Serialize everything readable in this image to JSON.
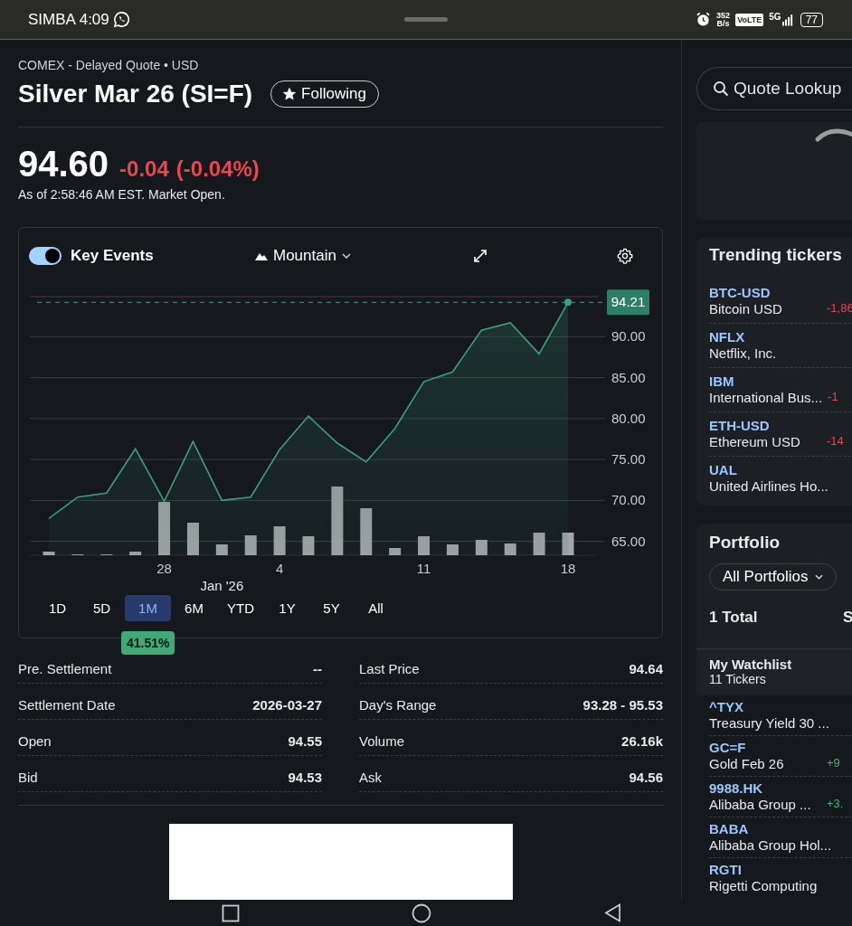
{
  "status_bar": {
    "carrier_time": "SIMBA 4:09",
    "speed_value": "352",
    "speed_unit": "B/s",
    "volte": "VoLTE",
    "network": "5G",
    "battery": "77"
  },
  "quote": {
    "source": "COMEX - Delayed Quote • USD",
    "title": "Silver Mar 26 (SI=F)",
    "follow": {
      "label": "Following",
      "selected": true
    },
    "price": "94.60",
    "change": "-0.04",
    "change_pct": "(-0.04%)",
    "as_of": "As of 2:58:46 AM EST. Market Open."
  },
  "chart_toolbar": {
    "key_events": {
      "label": "Key Events",
      "on": true
    },
    "chart_type": "Mountain"
  },
  "chart_data": {
    "type": "area",
    "grid": true,
    "ylim": [
      63.3,
      94.9
    ],
    "ref_lines": [
      {
        "axis": "y",
        "value": 94.2
      }
    ],
    "categories": [
      null,
      null,
      null,
      null,
      "28",
      null,
      null,
      null,
      "4",
      null,
      null,
      null,
      null,
      "11",
      null,
      null,
      null,
      null,
      "18"
    ],
    "series": [
      {
        "color": "#3d9f7f",
        "values": [
          67.8,
          70.4,
          70.9,
          76.3,
          69.9,
          77.2,
          70.0,
          70.4,
          76.2,
          80.3,
          77.0,
          74.7,
          78.8,
          84.5,
          85.7,
          90.8,
          91.7,
          87.9,
          94.2
        ]
      }
    ],
    "yticks": [
      {
        "value": 65,
        "label": "65.00"
      },
      {
        "value": 70,
        "label": "70.00"
      },
      {
        "value": 75,
        "label": "75.00"
      },
      {
        "value": 80,
        "label": "80.00"
      },
      {
        "value": 85,
        "label": "85.00"
      },
      {
        "value": 90,
        "label": "90.00"
      }
    ],
    "annotations": [
      "Jan '26",
      "94.21"
    ]
  },
  "ranges": [
    {
      "label": "1D",
      "selected": false
    },
    {
      "label": "5D",
      "selected": false
    },
    {
      "label": "1M",
      "selected": true
    },
    {
      "label": "6M",
      "selected": false
    },
    {
      "label": "YTD",
      "selected": false
    },
    {
      "label": "1Y",
      "selected": false
    },
    {
      "label": "5Y",
      "selected": false
    },
    {
      "label": "All",
      "selected": false
    }
  ],
  "range_change": "41.51%",
  "stats_left": [
    {
      "label": "Pre. Settlement",
      "value": "--"
    },
    {
      "label": "Settlement Date",
      "value": "2026-03-27"
    },
    {
      "label": "Open",
      "value": "94.55"
    },
    {
      "label": "Bid",
      "value": "94.53"
    }
  ],
  "stats_right": [
    {
      "label": "Last Price",
      "value": "94.64"
    },
    {
      "label": "Day's Range",
      "value": "93.28 - 95.53"
    },
    {
      "label": "Volume",
      "value": "26.16k"
    },
    {
      "label": "Ask",
      "value": "94.56"
    }
  ],
  "sidebar": {
    "search": {
      "placeholder": "Quote Lookup"
    },
    "trending": {
      "title": "Trending tickers",
      "items": [
        {
          "symbol": "BTC-USD",
          "name": "Bitcoin USD",
          "change": "-1,86",
          "color": "#e5484d"
        },
        {
          "symbol": "NFLX",
          "name": "Netflix, Inc."
        },
        {
          "symbol": "IBM",
          "name": "International Bus...",
          "change": "-1",
          "color": "#e5484d"
        },
        {
          "symbol": "ETH-USD",
          "name": "Ethereum USD",
          "change": "-14",
          "color": "#e5484d"
        },
        {
          "symbol": "UAL",
          "name": "United Airlines Ho..."
        }
      ]
    },
    "portfolio": {
      "title": "Portfolio",
      "selector": "All Portfolios",
      "total": "1 Total",
      "total_action": "S"
    },
    "watchlist": {
      "title": "My Watchlist",
      "count": "11 Tickers",
      "items": [
        {
          "symbol": "^TYX",
          "name": "Treasury Yield 30 ..."
        },
        {
          "symbol": "GC=F",
          "name": "Gold Feb 26",
          "change": "+9",
          "color": "#3fb27f"
        },
        {
          "symbol": "9988.HK",
          "name": "Alibaba Group ...",
          "change": "+3.",
          "color": "#3fb27f"
        },
        {
          "symbol": "BABA",
          "name": "Alibaba Group Hol..."
        },
        {
          "symbol": "RGTI",
          "name": "Rigetti Computing"
        }
      ]
    }
  }
}
